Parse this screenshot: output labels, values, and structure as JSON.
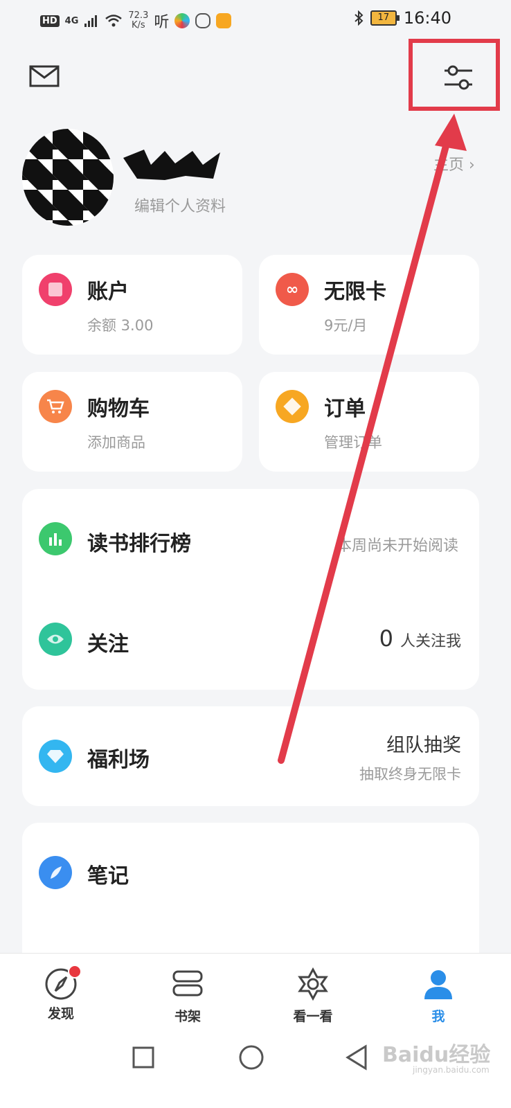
{
  "status_bar": {
    "hd": "HD",
    "network": "4G",
    "speed_value": "72.3",
    "speed_unit": "K/s",
    "listen": "听",
    "battery": "17",
    "time": "16:40"
  },
  "profile": {
    "edit_label": "编辑个人资料",
    "homepage_label": "主页"
  },
  "cards": {
    "account": {
      "title": "账户",
      "sub": "余额 3.00"
    },
    "unlimited": {
      "title": "无限卡",
      "sub": "9元/月"
    },
    "cart": {
      "title": "购物车",
      "sub": "添加商品"
    },
    "orders": {
      "title": "订单",
      "sub": "管理订单"
    },
    "ranking": {
      "title": "读书排行榜",
      "right": "本周尚未开始阅读"
    },
    "follow": {
      "title": "关注",
      "count": "0",
      "right": "人关注我"
    },
    "welfare": {
      "title": "福利场",
      "right_main": "组队抽奖",
      "right_sub": "抽取终身无限卡"
    },
    "notes": {
      "title": "笔记"
    }
  },
  "nav": [
    {
      "label": "发现",
      "icon": "compass-icon"
    },
    {
      "label": "书架",
      "icon": "bookshelf-icon"
    },
    {
      "label": "看一看",
      "icon": "star-icon"
    },
    {
      "label": "我",
      "icon": "person-icon"
    }
  ],
  "watermark": {
    "text": "Baidu经验",
    "url": "jingyan.baidu.com"
  },
  "colors": {
    "annotation_red": "#e23b4a",
    "nav_active": "#2a8ee8",
    "account_icon": "#f0406c",
    "unlimited_icon": "#f05a4a",
    "cart_icon": "#f7854a",
    "orders_icon": "#f7a722",
    "ranking_icon": "#3cc86e",
    "follow_icon": "#2fc49a",
    "welfare_icon": "#33b6f0",
    "notes_icon": "#3a8ef0"
  }
}
